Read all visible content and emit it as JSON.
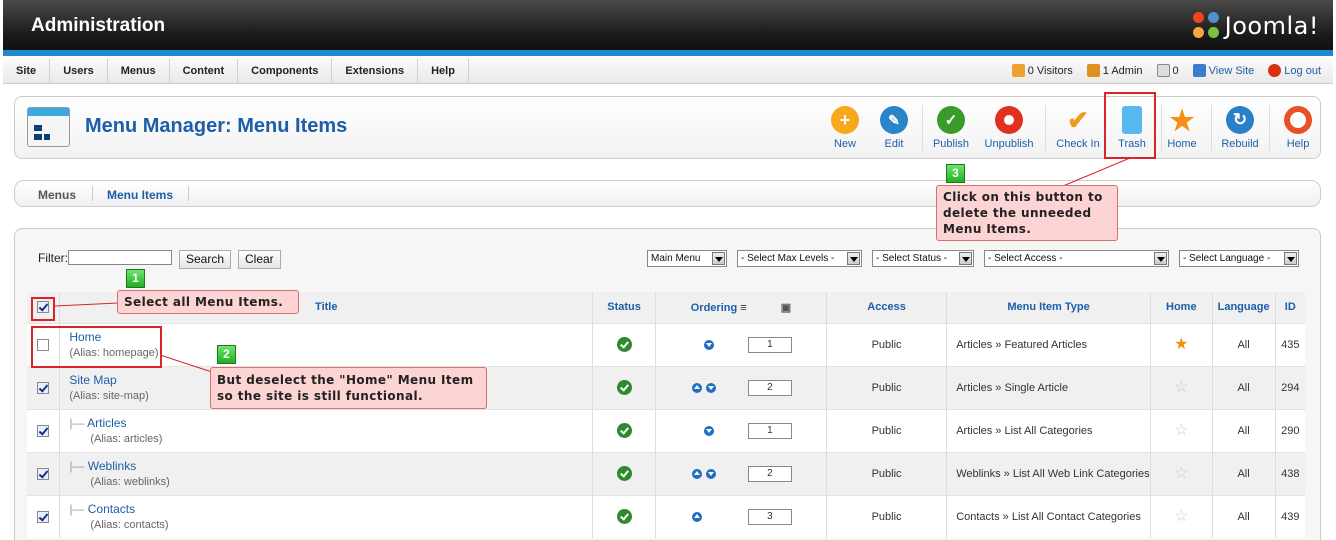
{
  "header": {
    "title": "Administration",
    "brand": "Joomla!"
  },
  "menu": [
    "Site",
    "Users",
    "Menus",
    "Content",
    "Components",
    "Extensions",
    "Help"
  ],
  "status": {
    "visitors": "0 Visitors",
    "admins": "1 Admin",
    "messages": "0",
    "view_site": "View Site",
    "logout": "Log out"
  },
  "page": {
    "title": "Menu Manager: Menu Items"
  },
  "toolbar": {
    "new": "New",
    "edit": "Edit",
    "publish": "Publish",
    "unpublish": "Unpublish",
    "checkin": "Check In",
    "trash": "Trash",
    "home": "Home",
    "rebuild": "Rebuild",
    "help": "Help"
  },
  "submenu": {
    "menus": "Menus",
    "items": "Menu Items"
  },
  "filter": {
    "label": "Filter:",
    "search": "Search",
    "clear": "Clear",
    "menu": "Main Menu",
    "levels": "- Select Max Levels -",
    "status": "- Select Status -",
    "access": "- Select Access -",
    "language": "- Select Language -"
  },
  "columns": {
    "title": "Title",
    "status": "Status",
    "ordering": "Ordering",
    "access": "Access",
    "type": "Menu Item Type",
    "home": "Home",
    "language": "Language",
    "id": "ID"
  },
  "rows": [
    {
      "title": "Home",
      "alias": "(Alias: homepage)",
      "order": "1",
      "access": "Public",
      "type": "Articles » Featured Articles",
      "lang": "All",
      "id": "435"
    },
    {
      "title": "Site Map",
      "alias": "(Alias: site-map)",
      "order": "2",
      "access": "Public",
      "type": "Articles » Single Article",
      "lang": "All",
      "id": "294"
    },
    {
      "title": "Articles",
      "alias": "(Alias: articles)",
      "order": "1",
      "access": "Public",
      "type": "Articles » List All Categories",
      "lang": "All",
      "id": "290"
    },
    {
      "title": "Weblinks",
      "alias": "(Alias: weblinks)",
      "order": "2",
      "access": "Public",
      "type": "Weblinks » List All Web Link Categories",
      "lang": "All",
      "id": "438"
    },
    {
      "title": "Contacts",
      "alias": "(Alias: contacts)",
      "order": "3",
      "access": "Public",
      "type": "Contacts » List All Contact Categories",
      "lang": "All",
      "id": "439"
    }
  ],
  "callouts": {
    "c1_num": "1",
    "c1": "Select all Menu Items.",
    "c2_num": "2",
    "c2a": "But deselect the \"Home\" Menu Item",
    "c2b": "so the site is still functional.",
    "c3_num": "3",
    "c3a": "Click on this button to",
    "c3b": "delete the unneeded",
    "c3c": "Menu Items."
  },
  "colors": {
    "accent": "#1d5ea8",
    "highlight": "#d9242b",
    "callout_bg": "#fcd4d4"
  }
}
